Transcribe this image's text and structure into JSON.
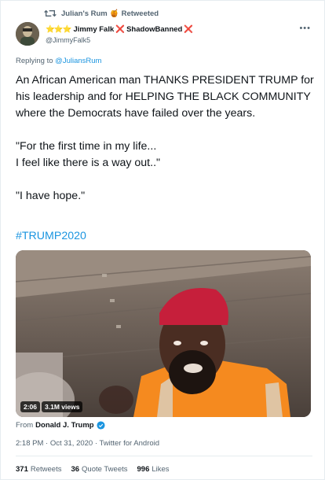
{
  "retweet_bar": {
    "icon": "retweet-icon",
    "retweeter": "Julian's Rum",
    "emoji": "🍯",
    "label": "Retweeted"
  },
  "author": {
    "stars": "⭐⭐⭐",
    "name": "Jimmy Falk",
    "x1": "❌",
    "banned_label": "ShadowBanned",
    "x2": "❌",
    "handle": "@JimmyFalk5"
  },
  "more_menu": "•••",
  "replying": {
    "prefix": "Replying to",
    "target": "@JuliansRum"
  },
  "tweet": {
    "p1": "An African American man THANKS PRESIDENT TRUMP for his leadership and for HELPING THE BLACK COMMUNITY where the Democrats have failed over the years.",
    "p2_line1": "\"For the first time in my life...",
    "p2_line2": "I feel like there is a way out..\"",
    "p3": "\"I have hope.\"",
    "hashtag": "#TRUMP2020"
  },
  "media": {
    "duration": "2:06",
    "views": "3.1M views"
  },
  "from": {
    "prefix": "From",
    "source": "Donald J. Trump"
  },
  "meta": "2:18 PM · Oct 31, 2020 · Twitter for Android",
  "stats": {
    "retweets_count": "371",
    "retweets_label": "Retweets",
    "quotes_count": "36",
    "quotes_label": "Quote Tweets",
    "likes_count": "996",
    "likes_label": "Likes"
  },
  "colors": {
    "link": "#1b95e0",
    "secondary": "#536471",
    "star": "#f4a01c",
    "red_x": "#e0245e"
  }
}
